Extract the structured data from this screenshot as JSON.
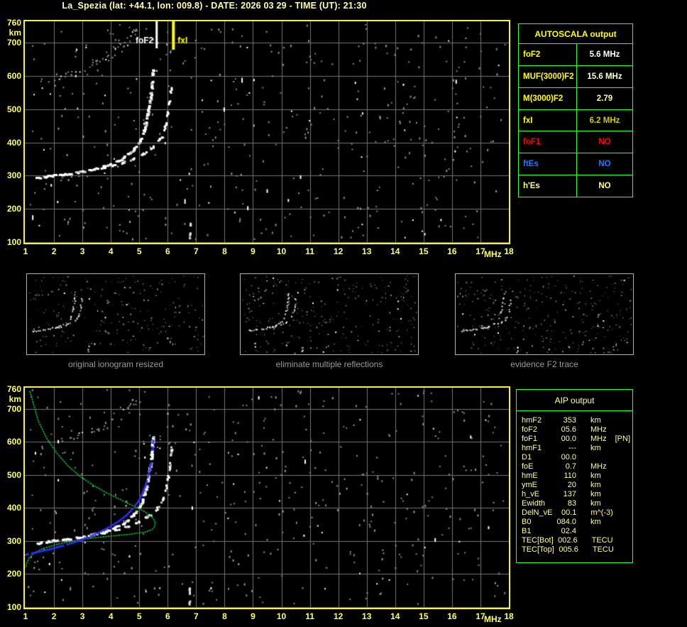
{
  "title": "La_Spezia (lat: +44.1, lon: 009.8) - DATE: 2026 03 29 - TIME (UT): 21:30",
  "colors": {
    "background": "#000000",
    "title_text": "#ffffb0",
    "plot_border": "#f4f440",
    "axis_label": "#ffff66",
    "grid": "#757575",
    "trace_white": "#ffffff",
    "noise_gray": "#8a8a8a",
    "table_border": "#33ff33",
    "autoscala_header": "#ffff00",
    "profile_green": "#00c83c",
    "restored_blue": "#2626ff",
    "fof2_marker": "#ffffff",
    "fxi_marker": "#ffff00",
    "thumb_border": "#b0b0b0",
    "caption_text": "#9a9a9a",
    "aip_text": "#ffff99"
  },
  "autoscala_table": {
    "header": "AUTOSCALA output",
    "rows": [
      {
        "label": "foF2",
        "value": "5.6 MHz",
        "label_color": "#ffff00",
        "value_color": "#ffffff"
      },
      {
        "label": "MUF(3000)F2",
        "value": "15.6 MHz",
        "label_color": "#ffff00",
        "value_color": "#ffffcc"
      },
      {
        "label": "M(3000)F2",
        "value": "2.79",
        "label_color": "#ffff00",
        "value_color": "#ffff99"
      },
      {
        "label": "fxI",
        "value": "6.2 MHz",
        "label_color": "#ffff00",
        "value_color": "#cccc00"
      },
      {
        "label": "foF1",
        "value": "NO",
        "label_color": "#ff0000",
        "value_color": "#ff0000"
      },
      {
        "label": "ftEs",
        "value": "NO",
        "label_color": "#2277ff",
        "value_color": "#2277ff"
      },
      {
        "label": "h'Es",
        "value": "NO",
        "label_color": "#ffff88",
        "value_color": "#ffff88"
      }
    ]
  },
  "thumbnails": [
    {
      "caption": "original ionogram resized"
    },
    {
      "caption": "eliminate multiple reflections"
    },
    {
      "caption": "evidence F2 trace"
    }
  ],
  "aip_table": {
    "header": "AIP output",
    "rows": [
      {
        "label": "hmF2",
        "value": "353",
        "unit": "km",
        "extra": ""
      },
      {
        "label": "foF2",
        "value": "05.6",
        "unit": "MHz",
        "extra": ""
      },
      {
        "label": "foF1",
        "value": "00.0",
        "unit": "MHz",
        "extra": "[PN]"
      },
      {
        "label": "hmF1",
        "value": "---",
        "unit": "km",
        "extra": ""
      },
      {
        "label": "D1",
        "value": "00.0",
        "unit": "",
        "extra": ""
      },
      {
        "label": "foE",
        "value": "0.7",
        "unit": "MHz",
        "extra": ""
      },
      {
        "label": "hmE",
        "value": "110",
        "unit": "km",
        "extra": ""
      },
      {
        "label": "ymE",
        "value": "20",
        "unit": "km",
        "extra": ""
      },
      {
        "label": "h_vE",
        "value": "137",
        "unit": "km",
        "extra": ""
      },
      {
        "label": "Ewidth",
        "value": "83",
        "unit": "km",
        "extra": ""
      },
      {
        "label": "DelN_vE",
        "value": "00.1",
        "unit": "m^(-3)",
        "extra": ""
      },
      {
        "label": "B0",
        "value": "084.0",
        "unit": "km",
        "extra": ""
      },
      {
        "label": "B1",
        "value": "02.4",
        "unit": "",
        "extra": ""
      },
      {
        "label": "TEC[Bot]",
        "value": "002.6",
        "unit": "TECU",
        "extra": ""
      },
      {
        "label": "TEC[Top]",
        "value": "005.6",
        "unit": "TECU",
        "extra": ""
      }
    ]
  },
  "chart_data": [
    {
      "id": "main_ionogram",
      "type": "scatter",
      "title": "autoscaled ionogram",
      "xlabel": "MHz",
      "ylabel": "km",
      "xlim": [
        1,
        18
      ],
      "ylim": [
        100,
        760
      ],
      "grid": true,
      "x_ticks": [
        1,
        2,
        3,
        4,
        5,
        6,
        7,
        8,
        9,
        10,
        11,
        12,
        13,
        14,
        15,
        16,
        17,
        18
      ],
      "y_ticks": [
        760,
        700,
        600,
        500,
        400,
        300,
        200,
        100
      ],
      "annotations": [
        {
          "label": "foF2",
          "x_mhz": 5.6,
          "color": "#ffffff"
        },
        {
          "label": "fxI",
          "x_mhz": 6.2,
          "color": "#ffff00"
        }
      ],
      "series": [
        {
          "name": "F2 ordinary echo trace",
          "color": "#ffffff",
          "style": "dash-heavy",
          "points": [
            [
              1.42,
              292
            ],
            [
              1.7,
              296
            ],
            [
              2.0,
              300
            ],
            [
              2.3,
              303
            ],
            [
              2.6,
              306
            ],
            [
              2.9,
              310
            ],
            [
              3.2,
              315
            ],
            [
              3.5,
              321
            ],
            [
              3.8,
              328
            ],
            [
              4.1,
              337
            ],
            [
              4.35,
              347
            ],
            [
              4.55,
              358
            ],
            [
              4.75,
              372
            ],
            [
              4.9,
              388
            ],
            [
              5.05,
              404
            ],
            [
              5.15,
              426
            ],
            [
              5.25,
              456
            ],
            [
              5.33,
              492
            ],
            [
              5.4,
              526
            ],
            [
              5.45,
              560
            ],
            [
              5.48,
              592
            ],
            [
              5.5,
              618
            ]
          ]
        },
        {
          "name": "F2 extraordinary echo trace",
          "color": "#ffffff",
          "style": "dash-light",
          "points": [
            [
              3.7,
              322
            ],
            [
              4.0,
              328
            ],
            [
              4.3,
              335
            ],
            [
              4.6,
              343
            ],
            [
              4.9,
              353
            ],
            [
              5.15,
              364
            ],
            [
              5.4,
              378
            ],
            [
              5.6,
              394
            ],
            [
              5.78,
              414
            ],
            [
              5.92,
              446
            ],
            [
              6.0,
              478
            ],
            [
              6.06,
              512
            ],
            [
              6.11,
              546
            ],
            [
              6.15,
              582
            ]
          ]
        },
        {
          "name": "second-hop multiple reflection echoes",
          "color": "#8d8d8d",
          "style": "diffuse",
          "points": [
            [
              1.5,
              585
            ],
            [
              1.8,
              592
            ],
            [
              2.1,
              600
            ],
            [
              2.4,
              607
            ],
            [
              2.7,
              614
            ],
            [
              3.0,
              622
            ],
            [
              3.3,
              632
            ],
            [
              3.6,
              644
            ],
            [
              3.9,
              658
            ],
            [
              4.2,
              676
            ],
            [
              4.45,
              694
            ],
            [
              4.65,
              714
            ],
            [
              4.8,
              736
            ],
            [
              4.9,
              756
            ]
          ]
        },
        {
          "name": "interference echoes",
          "color": "#e0e0e0",
          "style": "dash-light",
          "points": [
            [
              6.79,
              158
            ],
            [
              6.79,
              104
            ]
          ]
        }
      ]
    },
    {
      "id": "profile_ionogram",
      "type": "scatter",
      "title": "ionogram with AIP electron density profile and restored trace",
      "xlabel": "MHz",
      "ylabel": "km",
      "xlim": [
        1,
        18
      ],
      "ylim": [
        100,
        760
      ],
      "grid": true,
      "x_ticks": [
        1,
        2,
        3,
        4,
        5,
        6,
        7,
        8,
        9,
        10,
        11,
        12,
        13,
        14,
        15,
        16,
        17,
        18
      ],
      "y_ticks": [
        760,
        700,
        600,
        500,
        400,
        300,
        200,
        100
      ],
      "annotations": [],
      "series": [
        {
          "name": "F2 ordinary echo trace",
          "color": "#ffffff",
          "style": "dash-heavy",
          "points": [
            [
              1.42,
              292
            ],
            [
              1.7,
              296
            ],
            [
              2.0,
              300
            ],
            [
              2.3,
              303
            ],
            [
              2.6,
              306
            ],
            [
              2.9,
              310
            ],
            [
              3.2,
              315
            ],
            [
              3.5,
              321
            ],
            [
              3.8,
              328
            ],
            [
              4.1,
              337
            ],
            [
              4.35,
              347
            ],
            [
              4.55,
              358
            ],
            [
              4.75,
              372
            ],
            [
              4.9,
              388
            ],
            [
              5.05,
              404
            ],
            [
              5.15,
              426
            ],
            [
              5.25,
              456
            ],
            [
              5.33,
              492
            ],
            [
              5.4,
              526
            ],
            [
              5.45,
              560
            ],
            [
              5.48,
              592
            ],
            [
              5.5,
              618
            ]
          ]
        },
        {
          "name": "F2 extraordinary echo trace",
          "color": "#ffffff",
          "style": "dash-light",
          "points": [
            [
              3.7,
              322
            ],
            [
              4.0,
              328
            ],
            [
              4.3,
              335
            ],
            [
              4.6,
              343
            ],
            [
              4.9,
              353
            ],
            [
              5.15,
              364
            ],
            [
              5.4,
              378
            ],
            [
              5.6,
              394
            ],
            [
              5.78,
              414
            ],
            [
              5.92,
              446
            ],
            [
              6.0,
              478
            ],
            [
              6.06,
              512
            ],
            [
              6.11,
              546
            ],
            [
              6.15,
              582
            ]
          ]
        },
        {
          "name": "second-hop multiple reflection echoes",
          "color": "#8d8d8d",
          "style": "diffuse",
          "points": [
            [
              1.5,
              585
            ],
            [
              1.8,
              592
            ],
            [
              2.1,
              600
            ],
            [
              2.4,
              607
            ],
            [
              2.7,
              614
            ],
            [
              3.0,
              622
            ],
            [
              3.3,
              632
            ],
            [
              3.6,
              644
            ],
            [
              3.9,
              658
            ],
            [
              4.2,
              676
            ],
            [
              4.45,
              694
            ],
            [
              4.65,
              714
            ],
            [
              4.8,
              736
            ],
            [
              4.9,
              756
            ]
          ]
        },
        {
          "name": "interference echoes",
          "color": "#e0e0e0",
          "style": "dash-light",
          "points": [
            [
              6.79,
              158
            ],
            [
              6.79,
              104
            ]
          ]
        },
        {
          "name": "AIP electron density profile",
          "color": "#00c83c",
          "style": "line",
          "points": [
            [
              1.15,
              754
            ],
            [
              1.45,
              663
            ],
            [
              1.75,
              610
            ],
            [
              2.1,
              566
            ],
            [
              2.5,
              527
            ],
            [
              2.95,
              494
            ],
            [
              3.4,
              468
            ],
            [
              3.85,
              446
            ],
            [
              4.3,
              427
            ],
            [
              4.7,
              410
            ],
            [
              5.05,
              396
            ],
            [
              5.3,
              383
            ],
            [
              5.45,
              372
            ],
            [
              5.54,
              362
            ],
            [
              5.56,
              353
            ],
            [
              5.54,
              344
            ],
            [
              5.45,
              335
            ],
            [
              5.2,
              327
            ],
            [
              4.7,
              321
            ],
            [
              4.1,
              316
            ],
            [
              3.4,
              310
            ],
            [
              2.7,
              301
            ],
            [
              2.1,
              290
            ],
            [
              1.6,
              277
            ],
            [
              1.3,
              264
            ],
            [
              1.12,
              248
            ],
            [
              1.03,
              230
            ],
            [
              1.0,
              220
            ]
          ]
        },
        {
          "name": "restored ordinary trace",
          "color": "#2626ff",
          "style": "dots",
          "points": [
            [
              1.0,
              258
            ],
            [
              1.4,
              266
            ],
            [
              1.8,
              274
            ],
            [
              2.2,
              283
            ],
            [
              2.6,
              293
            ],
            [
              3.0,
              305
            ],
            [
              3.4,
              319
            ],
            [
              3.7,
              331
            ],
            [
              4.0,
              345
            ],
            [
              4.3,
              361
            ],
            [
              4.55,
              378
            ],
            [
              4.75,
              396
            ],
            [
              4.95,
              418
            ],
            [
              5.1,
              442
            ],
            [
              5.22,
              468
            ],
            [
              5.32,
              497
            ],
            [
              5.4,
              528
            ],
            [
              5.45,
              558
            ],
            [
              5.48,
              588
            ],
            [
              5.5,
              615
            ],
            [
              5.51,
              632
            ]
          ]
        }
      ]
    }
  ]
}
